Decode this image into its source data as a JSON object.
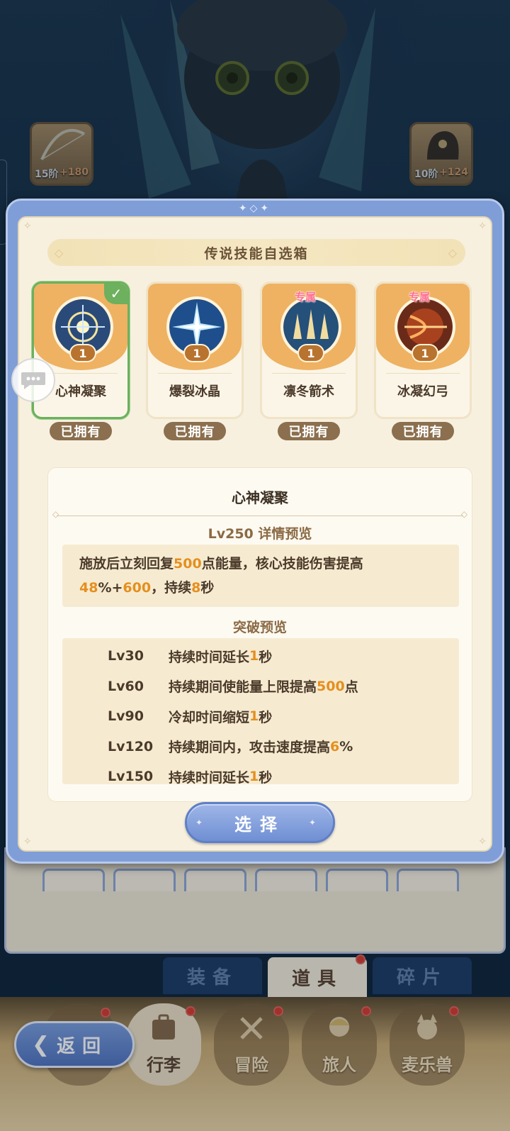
{
  "background": {
    "left_slot": {
      "tier": "15阶",
      "bonus": "+180"
    },
    "right_slot": {
      "tier": "10阶",
      "bonus": "+124"
    },
    "tabs": [
      {
        "label": "装备"
      },
      {
        "label": "道具"
      },
      {
        "label": "碎片"
      }
    ],
    "nav": [
      {
        "label": ""
      },
      {
        "label": "行李"
      },
      {
        "label": "冒险"
      },
      {
        "label": "旅人"
      },
      {
        "label": "麦乐兽"
      }
    ],
    "back_label": "返回"
  },
  "modal": {
    "title": "传说技能自选箱",
    "cards": [
      {
        "name": "心神凝聚",
        "level": "1",
        "exclusive": "",
        "owned": "已拥有",
        "selected": true
      },
      {
        "name": "爆裂冰晶",
        "level": "1",
        "exclusive": "",
        "owned": "已拥有",
        "selected": false
      },
      {
        "name": "凛冬箭术",
        "level": "1",
        "exclusive": "专属",
        "owned": "已拥有",
        "selected": false
      },
      {
        "name": "冰凝幻弓",
        "level": "1",
        "exclusive": "专属",
        "owned": "已拥有",
        "selected": false
      }
    ],
    "detail": {
      "skill_name": "心神凝聚",
      "preview_title": "Lv250 详情预览",
      "desc": {
        "t1": "施放后立刻回复",
        "v1": "500",
        "t2": "点能量，核心技能伤害提高",
        "v2": "48",
        "t3": "%+",
        "v3": "600",
        "t4": "，持续",
        "v4": "8",
        "t5": "秒"
      },
      "breakthrough_title": "突破预览",
      "breakthroughs": [
        {
          "level": "Lv30",
          "pre": "持续时间延长",
          "val": "1",
          "post": "秒"
        },
        {
          "level": "Lv60",
          "pre": "持续期间使能量上限提高",
          "val": "500",
          "post": "点"
        },
        {
          "level": "Lv90",
          "pre": "冷却时间缩短",
          "val": "1",
          "post": "秒"
        },
        {
          "level": "Lv120",
          "pre": "持续期间内，攻击速度提高",
          "val": "6",
          "post": "%"
        },
        {
          "level": "Lv150",
          "pre": "持续时间延长",
          "val": "1",
          "post": "秒"
        }
      ]
    },
    "select_label": "选择"
  },
  "colors": {
    "accent_blue": "#7f9ed7",
    "highlight_orange": "#e58f1e",
    "selected_green": "#6db05e",
    "exclusive_pink": "#ff6f8e"
  }
}
